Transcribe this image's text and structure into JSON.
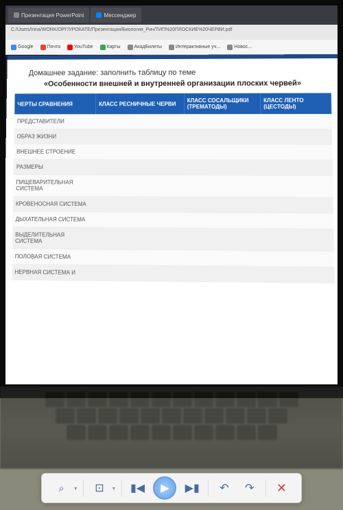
{
  "browser": {
    "tabs": [
      {
        "label": "Презентация PowerPoint"
      },
      {
        "label": "Мессенджер"
      }
    ],
    "url": "C:/Users/Irina/WORK/ОРГ/УРОКАТЕ/Презентации/Биология_Рич/ТИП%20ПЛОСКИЕ%20ЧЕРВИ.pdf",
    "bookmarks": [
      {
        "label": "Google",
        "color": "#4285f4"
      },
      {
        "label": "Почта",
        "color": "#ea4335"
      },
      {
        "label": "YouTube",
        "color": "#ff0000"
      },
      {
        "label": "Карты",
        "color": "#34a853"
      },
      {
        "label": "АкадБилеты",
        "color": "#888888"
      },
      {
        "label": "Интерактивные уч...",
        "color": "#888888"
      },
      {
        "label": "Новос...",
        "color": "#888888"
      }
    ]
  },
  "document": {
    "title_line1": "Домашнее задание: заполнить таблицу по теме",
    "title_line2": "«Особенности внешней и внутренней организации плоских червей»",
    "headers": {
      "col1": "ЧЕРТЫ СРАВНЕНИЯ",
      "col2": "КЛАСС РЕСНИЧНЫЕ ЧЕРВИ",
      "col3": "КЛАСС СОСАЛЬЩИКИ (ТРЕМАТОДЫ)",
      "col4": "КЛАСС ЛЕНТО (ЦЕСТОДЫ)"
    },
    "rows": [
      "ПРЕДСТАВИТЕЛИ",
      "ОБРАЗ ЖИЗНИ",
      "ВНЕШНЕЕ СТРОЕНИЕ",
      "РАЗМЕРЫ",
      "ПИЩЕВАРИТЕЛЬНАЯ СИСТЕМА",
      "КРОВЕНОСНАЯ СИСТЕМА",
      "ДЫХАТЕЛЬНАЯ СИСТЕМА",
      "ВЫДЕЛИТЕЛЬНАЯ СИСТЕМА",
      "ПОЛОВАЯ СИСТЕМА",
      "НЕРВНАЯ СИСТЕМА И"
    ]
  },
  "toolbar": {
    "zoom": "⌕",
    "fit": "⊡",
    "prev": "▮◀",
    "play": "▶",
    "next": "▶▮",
    "undo": "↶",
    "redo": "↷",
    "close": "✕"
  }
}
